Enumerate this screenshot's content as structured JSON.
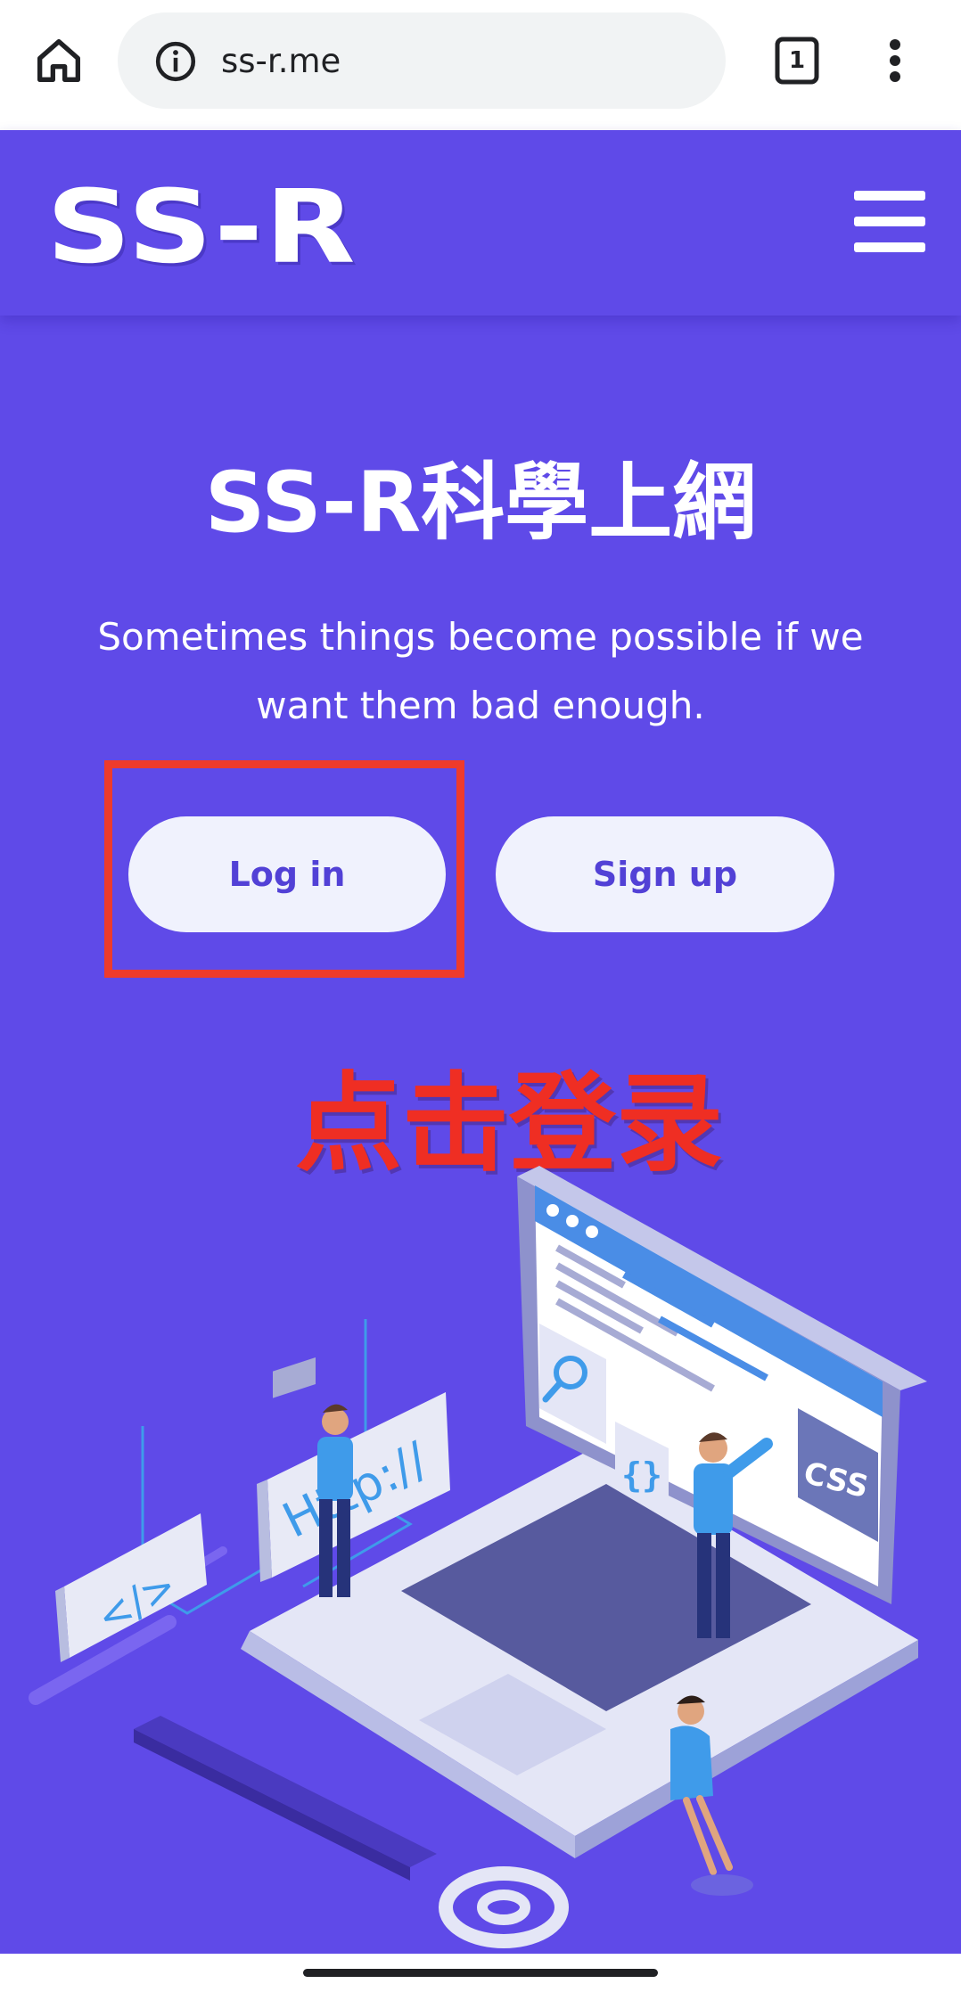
{
  "browser": {
    "url": "ss-r.me",
    "tab_count": "1"
  },
  "header": {
    "logo_text": "SS-R"
  },
  "hero": {
    "title": "SS-R科學上網",
    "subtitle": "Sometimes things become possible if we want them bad enough.",
    "login_label": "Log in",
    "signup_label": "Sign up"
  },
  "annotation": {
    "text": "点击登录"
  },
  "illustration": {
    "http_sign": "Http://",
    "code_sign": "</>",
    "braces_sign": "{}",
    "css_sign": "CSS"
  },
  "colors": {
    "page_background": "#5f4ae8",
    "button_background": "#f0f2fd",
    "button_text": "#5241d6",
    "annotation_red": "#ef2e23"
  }
}
